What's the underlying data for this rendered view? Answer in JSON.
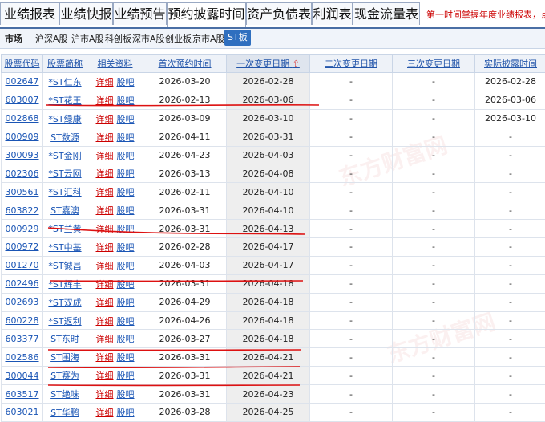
{
  "tabs": [
    "业绩报表",
    "业绩快报",
    "业绩预告",
    "预约披露时间",
    "资产负债表",
    "利润表",
    "现金流量表"
  ],
  "promo_text": "第一时间掌握年度业绩报表，点击",
  "filter": {
    "label": "市场",
    "items": [
      "沪深A股",
      "沪市A股",
      "科创板",
      "深市A股",
      "创业板",
      "京市A股",
      "ST板"
    ],
    "active": "ST板"
  },
  "table": {
    "headers": [
      "股票代码",
      "股票简称",
      "相关资料",
      "首次预约时间",
      "一次变更日期",
      "二次变更日期",
      "三次变更日期",
      "实际披露时间"
    ],
    "sorted_arrow": "⇧",
    "link_detail": "详细",
    "link_bar": "股吧",
    "rows": [
      {
        "code": "002647",
        "name": "*ST仁东",
        "first": "2026-03-20",
        "c1": "2026-02-28",
        "c2": "-",
        "c3": "-",
        "actual": "2026-02-28"
      },
      {
        "code": "603007",
        "name": "*ST花王",
        "first": "2026-02-13",
        "c1": "2026-03-06",
        "c2": "-",
        "c3": "-",
        "actual": "2026-03-06"
      },
      {
        "code": "002868",
        "name": "*ST绿康",
        "first": "2026-03-09",
        "c1": "2026-03-10",
        "c2": "-",
        "c3": "-",
        "actual": "2026-03-10"
      },
      {
        "code": "000909",
        "name": "ST数源",
        "first": "2026-04-11",
        "c1": "2026-03-31",
        "c2": "-",
        "c3": "-",
        "actual": "-"
      },
      {
        "code": "300093",
        "name": "*ST金刚",
        "first": "2026-04-23",
        "c1": "2026-04-03",
        "c2": "-",
        "c3": "-",
        "actual": "-"
      },
      {
        "code": "002306",
        "name": "*ST云网",
        "first": "2026-03-13",
        "c1": "2026-04-08",
        "c2": "-",
        "c3": "-",
        "actual": "-"
      },
      {
        "code": "300561",
        "name": "*ST汇科",
        "first": "2026-02-11",
        "c1": "2026-04-10",
        "c2": "-",
        "c3": "-",
        "actual": "-"
      },
      {
        "code": "603822",
        "name": "ST嘉澳",
        "first": "2026-03-31",
        "c1": "2026-04-10",
        "c2": "-",
        "c3": "-",
        "actual": "-"
      },
      {
        "code": "000929",
        "name": "*ST兰黄",
        "first": "2026-03-31",
        "c1": "2026-04-13",
        "c2": "-",
        "c3": "-",
        "actual": "-"
      },
      {
        "code": "000972",
        "name": "*ST中基",
        "first": "2026-02-28",
        "c1": "2026-04-17",
        "c2": "-",
        "c3": "-",
        "actual": "-"
      },
      {
        "code": "001270",
        "name": "*ST铖昌",
        "first": "2026-04-03",
        "c1": "2026-04-17",
        "c2": "-",
        "c3": "-",
        "actual": "-"
      },
      {
        "code": "002496",
        "name": "*ST辉丰",
        "first": "2026-03-31",
        "c1": "2026-04-18",
        "c2": "-",
        "c3": "-",
        "actual": "-"
      },
      {
        "code": "002693",
        "name": "*ST双成",
        "first": "2026-04-29",
        "c1": "2026-04-18",
        "c2": "-",
        "c3": "-",
        "actual": "-"
      },
      {
        "code": "600228",
        "name": "*ST返利",
        "first": "2026-04-26",
        "c1": "2026-04-18",
        "c2": "-",
        "c3": "-",
        "actual": "-"
      },
      {
        "code": "603377",
        "name": "ST东时",
        "first": "2026-03-27",
        "c1": "2026-04-18",
        "c2": "-",
        "c3": "-",
        "actual": "-"
      },
      {
        "code": "002586",
        "name": "ST围海",
        "first": "2026-03-31",
        "c1": "2026-04-21",
        "c2": "-",
        "c3": "-",
        "actual": "-"
      },
      {
        "code": "300044",
        "name": "ST赛为",
        "first": "2026-03-31",
        "c1": "2026-04-21",
        "c2": "-",
        "c3": "-",
        "actual": "-"
      },
      {
        "code": "603517",
        "name": "ST绝味",
        "first": "2026-03-31",
        "c1": "2026-04-23",
        "c2": "-",
        "c3": "-",
        "actual": "-"
      },
      {
        "code": "603021",
        "name": "ST华鹏",
        "first": "2026-03-28",
        "c1": "2026-04-25",
        "c2": "-",
        "c3": "-",
        "actual": "-"
      }
    ]
  },
  "watermark_text": "东方财富网",
  "colors": {
    "accent": "#2f6fbf",
    "link": "#1a55b5",
    "detail_link": "#cc0000",
    "annotation": "#cc0000"
  }
}
